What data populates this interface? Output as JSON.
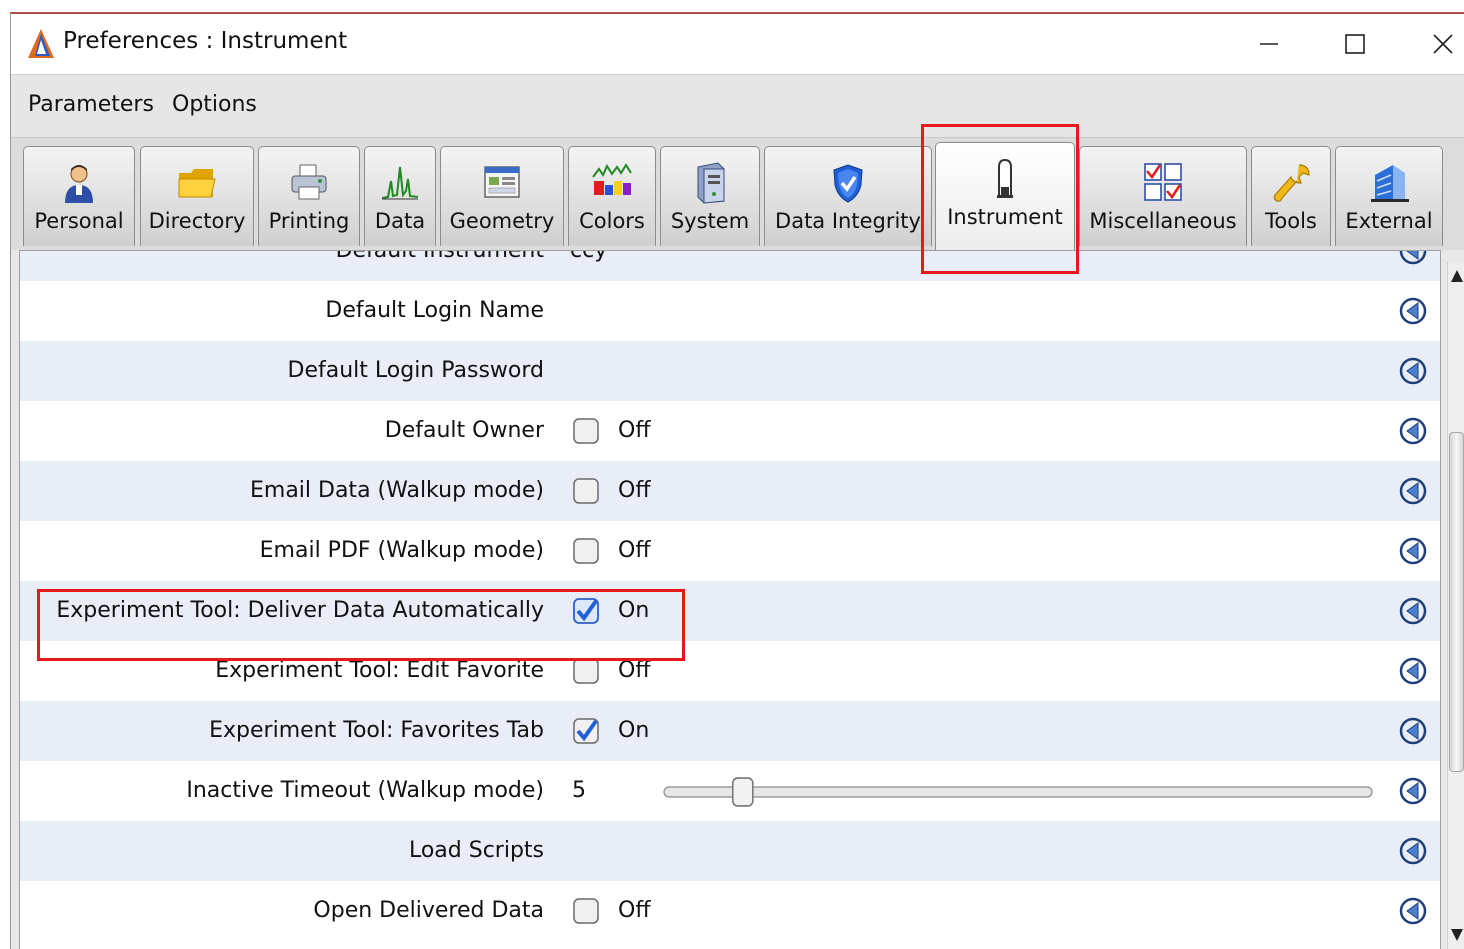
{
  "window": {
    "title": "Preferences : Instrument",
    "icon": "app-logo-icon"
  },
  "menu": {
    "items": [
      "Parameters",
      "Options"
    ]
  },
  "tabs": [
    {
      "label": "Personal",
      "icon": "person-icon"
    },
    {
      "label": "Directory",
      "icon": "folder-icon"
    },
    {
      "label": "Printing",
      "icon": "printer-icon"
    },
    {
      "label": "Data",
      "icon": "spectrum-icon"
    },
    {
      "label": "Geometry",
      "icon": "window-grid-icon"
    },
    {
      "label": "Colors",
      "icon": "color-bars-icon"
    },
    {
      "label": "System",
      "icon": "system-tower-icon"
    },
    {
      "label": "Data Integrity",
      "icon": "shield-check-icon"
    },
    {
      "label": "Instrument",
      "icon": "instrument-probe-icon",
      "active": true
    },
    {
      "label": "Miscellaneous",
      "icon": "checkbox-grid-icon"
    },
    {
      "label": "Tools",
      "icon": "wrench-icon"
    },
    {
      "label": "External",
      "icon": "building-icon"
    }
  ],
  "rows": {
    "partial_top": {
      "label": "Default Instrument",
      "value": "ccy"
    },
    "default_login_name": {
      "label": "Default Login Name",
      "value": ""
    },
    "default_login_password": {
      "label": "Default Login Password",
      "value": ""
    },
    "default_owner": {
      "label": "Default Owner",
      "state": "Off",
      "checked": false
    },
    "email_data": {
      "label": "Email Data (Walkup mode)",
      "state": "Off",
      "checked": false
    },
    "email_pdf": {
      "label": "Email PDF (Walkup mode)",
      "state": "Off",
      "checked": false
    },
    "deliver_auto": {
      "label": "Experiment Tool: Deliver Data Automatically",
      "state": "On",
      "checked": true
    },
    "edit_favorite": {
      "label": "Experiment Tool: Edit Favorite",
      "state": "Off",
      "checked": false
    },
    "favorites_tab": {
      "label": "Experiment Tool: Favorites Tab",
      "state": "On",
      "checked": true
    },
    "inactive_timeout": {
      "label": "Inactive Timeout (Walkup mode)",
      "value": "5",
      "slider_fraction": 0.1
    },
    "load_scripts": {
      "label": "Load Scripts",
      "value": ""
    },
    "open_delivered": {
      "label": "Open Delivered Data",
      "state": "Off",
      "checked": false
    }
  },
  "colors": {
    "highlight": "#e8191a",
    "row_alt": "#e8edf7",
    "check_blue": "#1f5fd8"
  }
}
